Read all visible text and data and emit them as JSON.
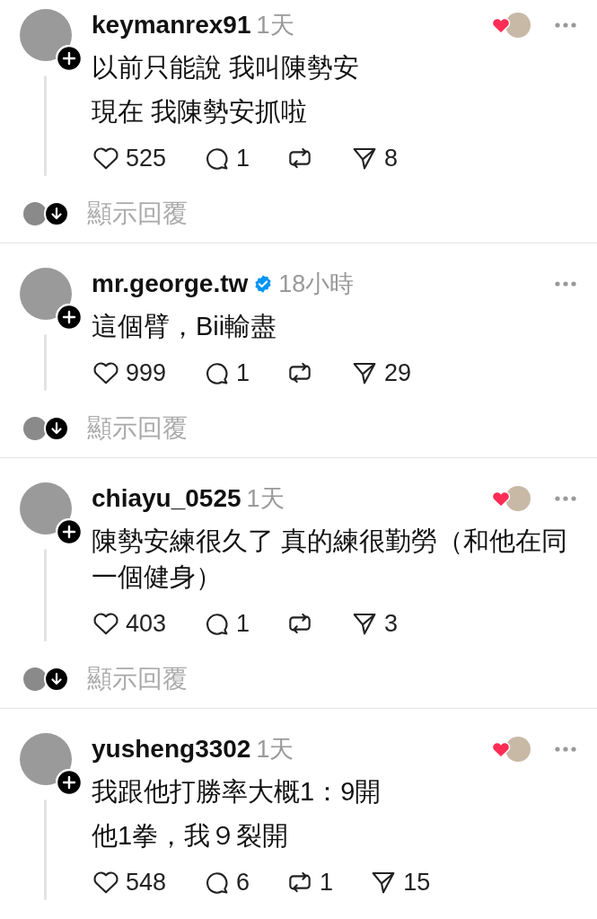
{
  "posts": [
    {
      "username": "keymanrex91",
      "verified": false,
      "time": "1天",
      "liked_by_author": true,
      "paragraphs": [
        "以前只能說 我叫陳勢安",
        "現在 我陳勢安抓啦"
      ],
      "likes": "525",
      "replies": "1",
      "shares": "8",
      "show_replies": "顯示回覆"
    },
    {
      "username": "mr.george.tw",
      "verified": true,
      "time": "18小時",
      "liked_by_author": false,
      "paragraphs": [
        "這個臂，Bii輸盡"
      ],
      "likes": "999",
      "replies": "1",
      "shares": "29",
      "show_replies": "顯示回覆"
    },
    {
      "username": "chiayu_0525",
      "verified": false,
      "time": "1天",
      "liked_by_author": true,
      "paragraphs": [
        "陳勢安練很久了 真的練很勤勞（和他在同一個健身）"
      ],
      "likes": "403",
      "replies": "1",
      "shares": "3",
      "show_replies": "顯示回覆"
    },
    {
      "username": "yusheng3302",
      "verified": false,
      "time": "1天",
      "liked_by_author": true,
      "paragraphs": [
        "我跟他打勝率大概1：9開",
        "他1拳，我９裂開"
      ],
      "likes": "548",
      "replies": "6",
      "reposts": "1",
      "shares": "15"
    }
  ]
}
